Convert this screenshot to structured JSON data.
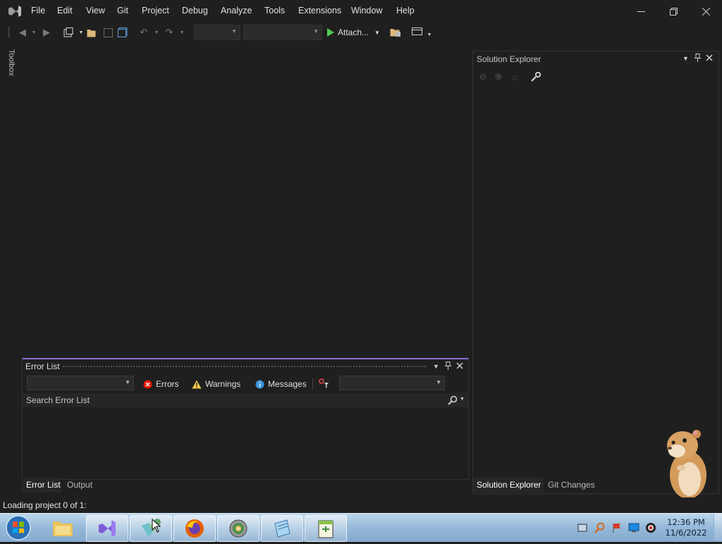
{
  "menu": {
    "items": [
      "File",
      "Edit",
      "View",
      "Git",
      "Project",
      "Debug",
      "Analyze",
      "Tools",
      "Extensions",
      "Window",
      "Help"
    ]
  },
  "window_controls": {
    "minimize_icon": "minimize-icon",
    "restore_icon": "restore-icon",
    "close_icon": "close-icon"
  },
  "toolbar": {
    "attach_label": "Attach...",
    "accent": "#4ec94e"
  },
  "toolbox": {
    "label": "Toolbox"
  },
  "solution_explorer": {
    "title": "Solution Explorer",
    "tabs": [
      "Solution Explorer",
      "Git Changes"
    ]
  },
  "error_list": {
    "title": "Error List",
    "errors_label": "Errors",
    "warnings_label": "Warnings",
    "messages_label": "Messages",
    "search_placeholder": "Search Error List",
    "tabs": [
      "Error List",
      "Output"
    ],
    "accent": "#8a6fd6"
  },
  "status": {
    "text": "Loading project 0 of 1:"
  },
  "taskbar": {
    "time": "12:36 PM",
    "date": "11/6/2022",
    "apps": [
      "file-explorer-icon",
      "visual-studio-icon",
      "installer-icon",
      "firefox-icon",
      "cd-dvd-icon",
      "notepad-icon",
      "notepad-plus-icon"
    ]
  }
}
